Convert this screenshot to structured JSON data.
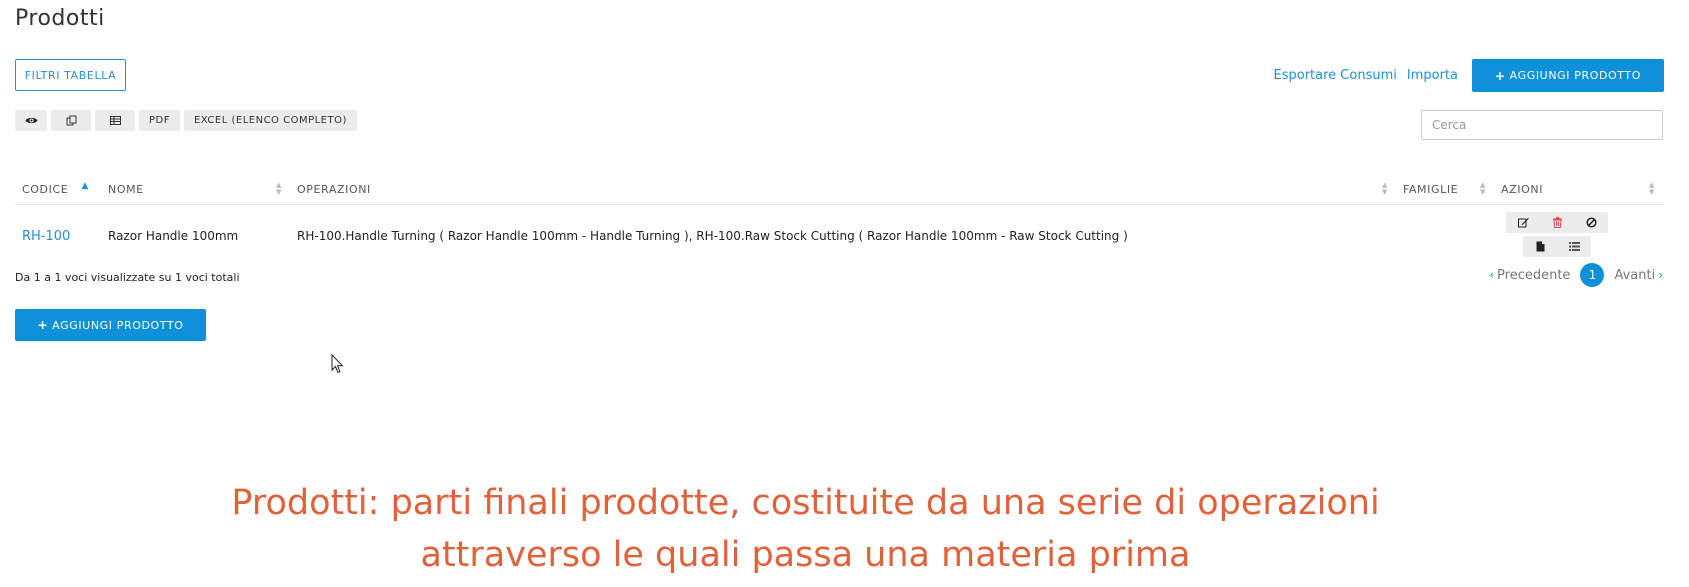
{
  "page": {
    "title": "Prodotti"
  },
  "toolbar": {
    "filter_label": "FILTRI TABELLA",
    "export_link": "Esportare Consumi",
    "import_link": "Importa",
    "add_label": "AGGIUNGI PRODOTTO",
    "add_plus": "+"
  },
  "tools": {
    "view_icon": "eye-icon",
    "copy_icon": "copy-icon",
    "csv_icon": "table-icon",
    "pdf_label": "PDF",
    "excel_label": "EXCEL (ELENCO COMPLETO)"
  },
  "search": {
    "placeholder": "Cerca",
    "value": ""
  },
  "table": {
    "columns": [
      "CODICE",
      "NOME",
      "OPERAZIONI",
      "FAMIGLIE",
      "AZIONI"
    ],
    "sorted_column": "CODICE",
    "sort_direction": "ascending",
    "rows": [
      {
        "code": "RH-100",
        "name": "Razor Handle 100mm",
        "operations": "RH-100.Handle Turning ( Razor Handle 100mm - Handle Turning ), RH-100.Raw Stock Cutting ( Razor Handle 100mm - Raw Stock Cutting )",
        "families": "",
        "actions": [
          "edit-icon",
          "delete-icon",
          "disable-icon",
          "document-icon",
          "list-icon"
        ]
      }
    ]
  },
  "footer": {
    "info": "Da 1 a 1 voci visualizzate su 1 voci totali",
    "prev_label": "Precedente",
    "next_label": "Avanti",
    "current_page": "1"
  },
  "caption": {
    "text": "Prodotti: parti finali prodotte, costituite da una serie di operazioni attraverso le quali passa una materia prima"
  },
  "colors": {
    "primary": "#0e91d9",
    "link": "#1f8ed4",
    "danger": "#e04848",
    "caption": "#e0623a"
  }
}
